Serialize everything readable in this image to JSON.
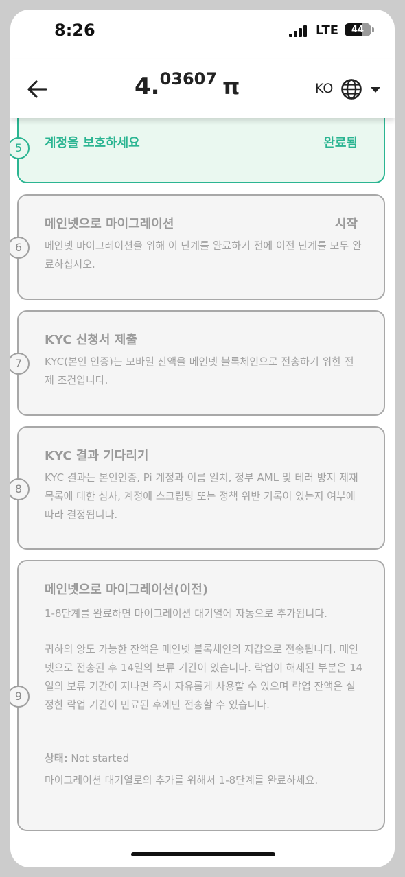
{
  "status_bar": {
    "time": "8:26",
    "network": "LTE",
    "battery": "44"
  },
  "header": {
    "balance_int": "4.",
    "balance_dec": "03607",
    "currency_symbol": "π",
    "language": "KO"
  },
  "steps": [
    {
      "number": "5",
      "title": "계정을 보호하세요",
      "status": "완료됨"
    },
    {
      "number": "6",
      "title": "메인넷으로 마이그레이션",
      "status": "시작",
      "description": "메인넷 마이그레이션을 위해 이 단계를 완료하기 전에 이전 단계를 모두 완료하십시오."
    },
    {
      "number": "7",
      "title": "KYC 신청서 제출",
      "description": "KYC(본인 인증)는 모바일 잔액을 메인넷 블록체인으로 전송하기 위한 전제 조건입니다."
    },
    {
      "number": "8",
      "title": "KYC 결과 기다리기",
      "description": "KYC 결과는 본인인증, Pi 계정과 이름 일치, 정부 AML 및 테러 방지 제재 목록에 대한 심사, 계정에 스크립팅 또는 정책 위반 기록이 있는지 여부에 따라 결정됩니다."
    },
    {
      "number": "9",
      "title": "메인넷으로 마이그레이션(이전)",
      "description_1": "1-8단계를 완료하면 마이그레이션 대기열에 자동으로 추가됩니다.",
      "description_2": "귀하의 양도 가능한 잔액은 메인넷 블록체인의 지갑으로 전송됩니다. 메인넷으로 전송된 후 14일의 보류 기간이 있습니다. 락업이 해제된 부분은 14일의 보류 기간이 지나면 즉시 자유롭게 사용할 수 있으며 락업 잔액은 설정한 락업 기간이 만료된 후에만 전송할 수 있습니다.",
      "status_label": "상태:",
      "status_value": "Not started",
      "note": "마이그레이션 대기열로의 추가를 위해서 1-8단계를 완료하세요."
    }
  ],
  "colors": {
    "done": "#2bb592",
    "pending": "#a8a8a8"
  }
}
